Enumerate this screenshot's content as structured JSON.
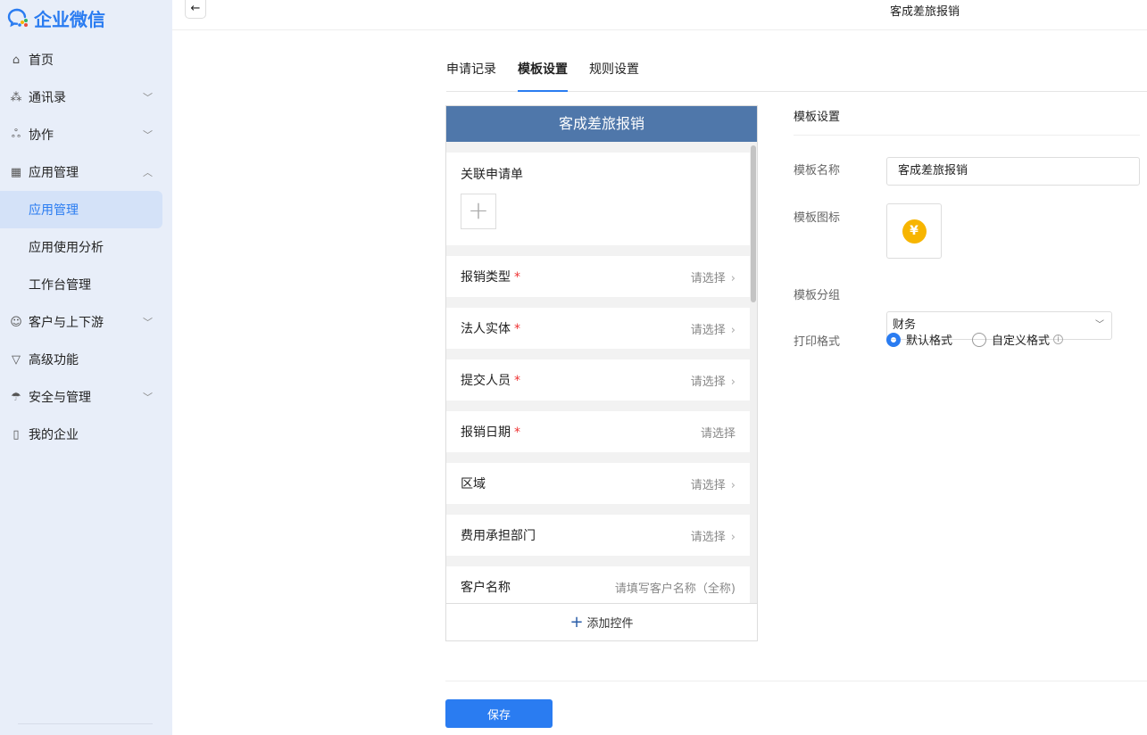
{
  "app": {
    "name": "企业微信"
  },
  "sidebar": {
    "items": [
      {
        "label": "首页",
        "icon": "home-icon",
        "glyph": "⌂"
      },
      {
        "label": "通讯录",
        "icon": "org-icon",
        "glyph": "⁂",
        "chevron": "﹀"
      },
      {
        "label": "协作",
        "icon": "collab-icon",
        "glyph": "ஃ",
        "chevron": "﹀"
      },
      {
        "label": "应用管理",
        "icon": "apps-icon",
        "glyph": "▦",
        "chevron": "︿"
      },
      {
        "label": "应用管理",
        "sub": true,
        "active": true
      },
      {
        "label": "应用使用分析",
        "sub": true
      },
      {
        "label": "工作台管理",
        "sub": true
      },
      {
        "label": "客户与上下游",
        "icon": "chat-icon",
        "glyph": "☺",
        "chevron": "﹀"
      },
      {
        "label": "高级功能",
        "icon": "advanced-icon",
        "glyph": "▽"
      },
      {
        "label": "安全与管理",
        "icon": "umbrella-icon",
        "glyph": "☂",
        "chevron": "﹀"
      },
      {
        "label": "我的企业",
        "icon": "building-icon",
        "glyph": "▯"
      }
    ]
  },
  "header": {
    "title": "客成差旅报销",
    "back": "←"
  },
  "tabs": [
    "申请记录",
    "模板设置",
    "规则设置"
  ],
  "preview": {
    "title": "客成差旅报销",
    "linked_label": "关联申请单",
    "fields": [
      {
        "label": "报销类型",
        "required": true,
        "placeholder": "请选择",
        "arrow": true
      },
      {
        "label": "法人实体",
        "required": true,
        "placeholder": "请选择",
        "arrow": true
      },
      {
        "label": "提交人员",
        "required": true,
        "placeholder": "请选择",
        "arrow": true
      },
      {
        "label": "报销日期",
        "required": true,
        "placeholder": "请选择",
        "arrow": false
      },
      {
        "label": "区域",
        "required": false,
        "placeholder": "请选择",
        "arrow": true
      },
      {
        "label": "费用承担部门",
        "required": false,
        "placeholder": "请选择",
        "arrow": true
      },
      {
        "label": "客户名称",
        "required": false,
        "placeholder": "请填写客户名称（全称)",
        "arrow": false
      }
    ],
    "add_label": "添加控件"
  },
  "settings": {
    "title": "模板设置",
    "name_label": "模板名称",
    "name_value": "客成差旅报销",
    "icon_label": "模板图标",
    "icon_glyph": "¥",
    "group_label": "模板分组",
    "group_value": "财务",
    "print_label": "打印格式",
    "print_options": [
      "默认格式",
      "自定义格式"
    ],
    "print_selected": 0
  },
  "save_label": "保存",
  "colors": {
    "accent": "#2a7cf1",
    "preview_header": "#4f77aa",
    "icon_bg": "#f7b500"
  }
}
